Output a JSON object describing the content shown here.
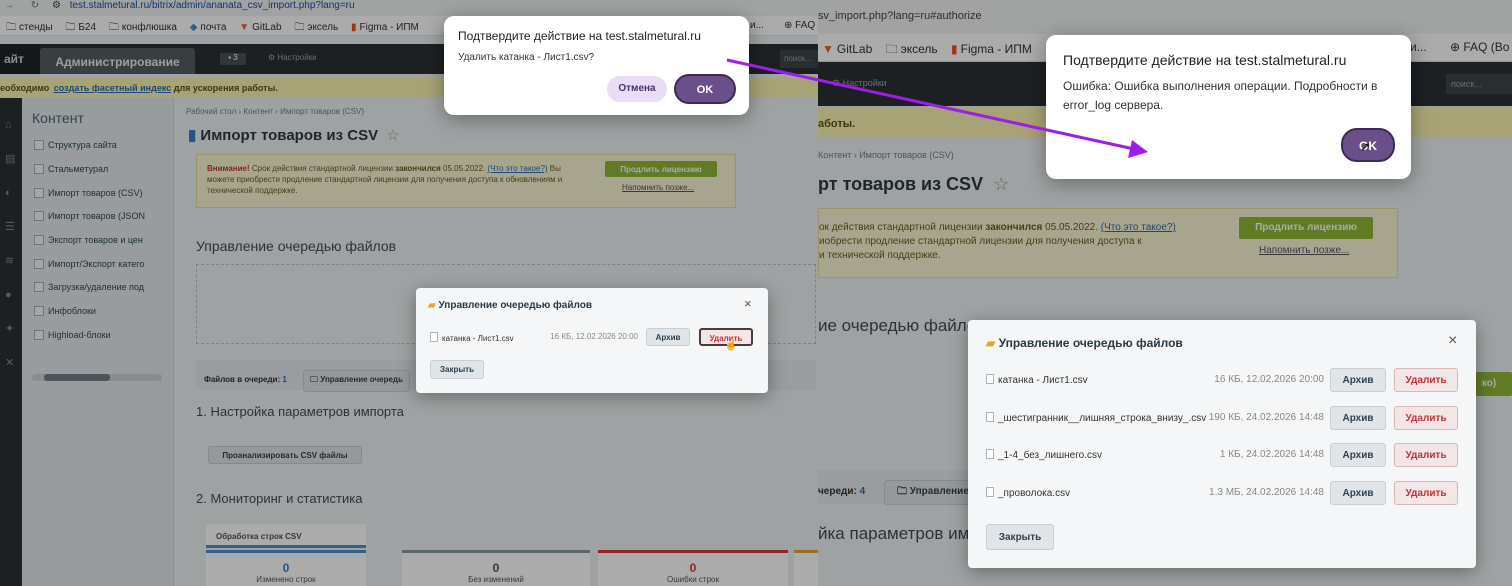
{
  "left": {
    "url": "test.stalmetural.ru/bitrix/admin/ananata_csv_import.php?lang=ru",
    "bookmarks": [
      "стенды",
      "Б24",
      "конфлюшка",
      "почта",
      "GitLab",
      "эксель",
      "Figma - ИПМ"
    ],
    "bookmarks_tail": [
      "и...",
      "FAQ"
    ],
    "site_tab": "айт",
    "admin_tab": "Администрирование",
    "notif_count": "3",
    "settings_label": "Настройки",
    "search_label": "поиск...",
    "notice_text": "еобходимо",
    "notice_link": "создать фасетный индекс",
    "notice_tail": "для ускорения работы.",
    "sidebar_title": "Контент",
    "sidebar_items": [
      "Структура сайта",
      "Стальметурал",
      "Импорт товаров (CSV)",
      "Импорт товаров (JSON",
      "Экспорт товаров и цен",
      "Импорт/Экспорт катего",
      "Загрузка/удаление под",
      "Инфоблоки",
      "Highload-блоки"
    ],
    "breadcrumb": "Рабочий стол  ›  Контент  ›  Импорт товаров (CSV)",
    "page_title": "Импорт товаров из CSV",
    "license_warning": "Внимание!",
    "license_text": "Срок действия стандартной лицензии",
    "license_bold": "закончился",
    "license_date": "05.05.2022.",
    "license_link": "(Что это такое?)",
    "license_text2": "Вы можете приобрести продление стандартной лицензии для получения доступа к обновлениям и технической поддержке.",
    "renew_btn": "Продлить лицензию",
    "remind_link": "Напомнить позже...",
    "queue_title": "Управление очередью файлов",
    "queue_files_label": "Файлов в очереди:",
    "queue_files_count": "1",
    "queue_manage_btn": "Управление очередь",
    "section1": "1. Настройка параметров импорта",
    "analyze_btn": "Проанализировать CSV файлы",
    "section2": "2. Мониторинг и статистика",
    "processing_label": "Обработка строк CSV",
    "stats": [
      {
        "value": "0",
        "label": "Изменено строк"
      },
      {
        "value": "0",
        "label": "Без изменений"
      },
      {
        "value": "0",
        "label": "Ошибки строк"
      }
    ],
    "modal": {
      "title": "Управление очередью файлов",
      "file_name": "катанка - Лист1.csv",
      "file_meta": "16 КБ, 12.02.2026 20:00",
      "archive_btn": "Архив",
      "delete_btn": "Удалить",
      "close_btn": "Закрыть"
    },
    "confirm": {
      "title": "Подтвердите действие на test.stalmetural.ru",
      "message": "Удалить  катанка - Лист1.csv?",
      "cancel": "Отмена",
      "ok": "OK"
    }
  },
  "right": {
    "url": "sv_import.php?lang=ru#authorize",
    "bookmarks": [
      "GitLab",
      "эксель",
      "Figma - ИПМ"
    ],
    "bookmarks_tail": [
      "и...",
      "FAQ (Bo"
    ],
    "settings_label": "Настройки",
    "search_label": "поиск...",
    "notice_tail": "аботы.",
    "breadcrumb": "Контент  ›  Импорт товаров (CSV)",
    "page_title": "рт товаров из CSV",
    "license_text": "ок действия стандартной лицензии",
    "license_bold": "закончился",
    "license_date": "05.05.2022.",
    "license_link": "(Что это такое?)",
    "license_text2": "иобрести продление стандартной лицензии для получения доступа к",
    "license_text3": "и технической поддержке.",
    "renew_btn": "Продлить лицензию",
    "remind_link": "Напомнить позже...",
    "queue_title": "ие очередью файло",
    "queue_files_label": "череди:",
    "queue_files_count": "4",
    "queue_manage_btn": "Управление",
    "section1": "йка параметров им",
    "side_btn_tail": "ко)",
    "modal": {
      "title": "Управление очередью файлов",
      "files": [
        {
          "name": "катанка - Лист1.csv",
          "meta": "16 КБ, 12.02.2026 20:00"
        },
        {
          "name": "_шестигранник__лишняя_строка_внизу_.csv",
          "meta": "190 КБ, 24.02.2026 14:48"
        },
        {
          "name": "_1-4_без_лишнего.csv",
          "meta": "1 КБ, 24.02.2026 14:48"
        },
        {
          "name": "_проволока.csv",
          "meta": "1.3 МБ, 24.02.2026 14:48"
        }
      ],
      "archive_btn": "Архив",
      "delete_btn": "Удалить",
      "close_btn": "Закрыть"
    },
    "alert": {
      "title": "Подтвердите действие на test.stalmetural.ru",
      "message": "Ошибка: Ошибка выполнения операции. Подробности в error_log сервера.",
      "ok": "OK"
    }
  },
  "colors": {
    "arrow": "#9b1fe8",
    "pill_ok": "#6b4f8a",
    "pill_cancel": "#e9dcf5",
    "admin_bar": "#2b3134",
    "green": "#8fb836",
    "delete_red": "#c8303a"
  }
}
